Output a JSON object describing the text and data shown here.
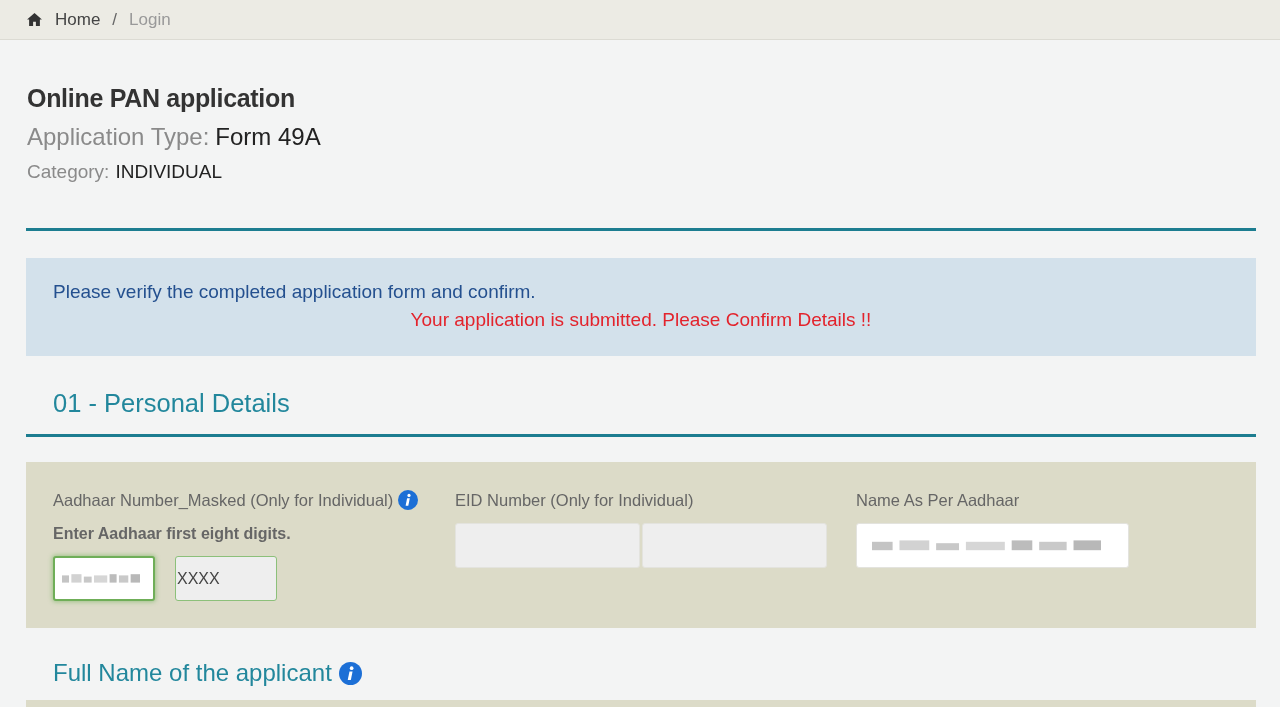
{
  "breadcrumb": {
    "items": [
      {
        "label": "Home",
        "kind": "home"
      },
      {
        "label": "Login",
        "kind": "current"
      }
    ],
    "separator": "/"
  },
  "header": {
    "title": "Online PAN application",
    "application_type": {
      "label": "Application Type:",
      "value": "Form 49A"
    },
    "category": {
      "label": "Category:",
      "value": "INDIVIDUAL"
    }
  },
  "alert": {
    "message": "Please verify the completed application form and confirm.",
    "status": "Your application is submitted. Please Confirm Details !!"
  },
  "sections": [
    {
      "title": "01 - Personal Details",
      "fields": [
        {
          "label": "Aadhaar Number_Masked (Only for Individual)",
          "info": true,
          "hint": "Enter Aadhaar first eight digits.",
          "inputs": [
            {
              "redacted": true,
              "focused": true,
              "valid": true,
              "disabled": false
            },
            {
              "value": "XXXX",
              "redacted": false,
              "focused": false,
              "valid": true,
              "disabled": true
            }
          ]
        },
        {
          "label": "EID Number (Only for Individual)",
          "info": false,
          "inputs": [
            {
              "redacted": false,
              "focused": false,
              "valid": false,
              "disabled": true
            },
            {
              "redacted": false,
              "focused": false,
              "valid": false,
              "disabled": true
            }
          ]
        },
        {
          "label": "Name As Per Aadhaar",
          "info": false,
          "inputs": [
            {
              "redacted": true,
              "focused": false,
              "valid": false,
              "disabled": false
            }
          ]
        }
      ],
      "subsections": [
        {
          "title": "Full Name of the applicant",
          "info": true
        }
      ]
    }
  ]
}
